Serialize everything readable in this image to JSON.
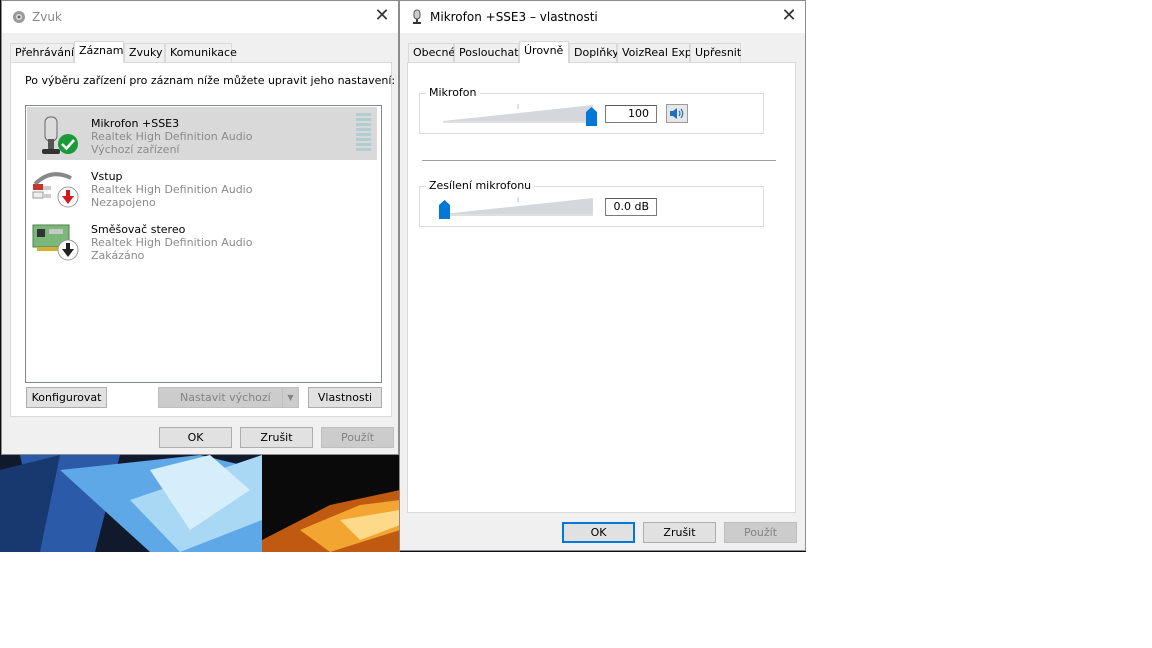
{
  "sound_dialog": {
    "title": "Zvuk",
    "tabs": [
      "Přehrávání",
      "Záznam",
      "Zvuky",
      "Komunikace"
    ],
    "active_tab": "Záznam",
    "instruction": "Po výběru zařízení pro záznam níže můžete upravit jeho nastavení:",
    "devices": [
      {
        "name": "Mikrofon +SSE3",
        "driver": "Realtek High Definition Audio",
        "status": "Výchozí zařízení",
        "icon": "microphone-icon",
        "badge": "default-check-icon"
      },
      {
        "name": "Vstup",
        "driver": "Realtek High Definition Audio",
        "status": "Nezapojeno",
        "icon": "audio-jack-icon",
        "badge": "unplugged-arrow-icon"
      },
      {
        "name": "Směšovač stereo",
        "driver": "Realtek High Definition Audio",
        "status": "Zakázáno",
        "icon": "sound-card-icon",
        "badge": "disabled-arrow-icon"
      }
    ],
    "buttons": {
      "configure": "Konfigurovat",
      "set_default": "Nastavit výchozí",
      "properties": "Vlastnosti",
      "ok": "OK",
      "cancel": "Zrušit",
      "apply": "Použít"
    }
  },
  "mic_properties": {
    "title": "Mikrofon +SSE3 – vlastnosti",
    "tabs": [
      "Obecné",
      "Poslouchat",
      "Úrovně",
      "Doplňky",
      "VoizReal Exp",
      "Upřesnit"
    ],
    "active_tab": "Úrovně",
    "microphone": {
      "label": "Mikrofon",
      "value": "100",
      "level_fraction": 1.0
    },
    "boost": {
      "label": "Zesílení mikrofonu",
      "value": "0.0 dB",
      "level_fraction": 0.0
    },
    "buttons": {
      "ok": "OK",
      "cancel": "Zrušit",
      "apply": "Použít"
    }
  },
  "colors": {
    "accent": "#0078d7",
    "selected_row": "#d9d9d9",
    "secondary_text": "#8a8a8a"
  }
}
